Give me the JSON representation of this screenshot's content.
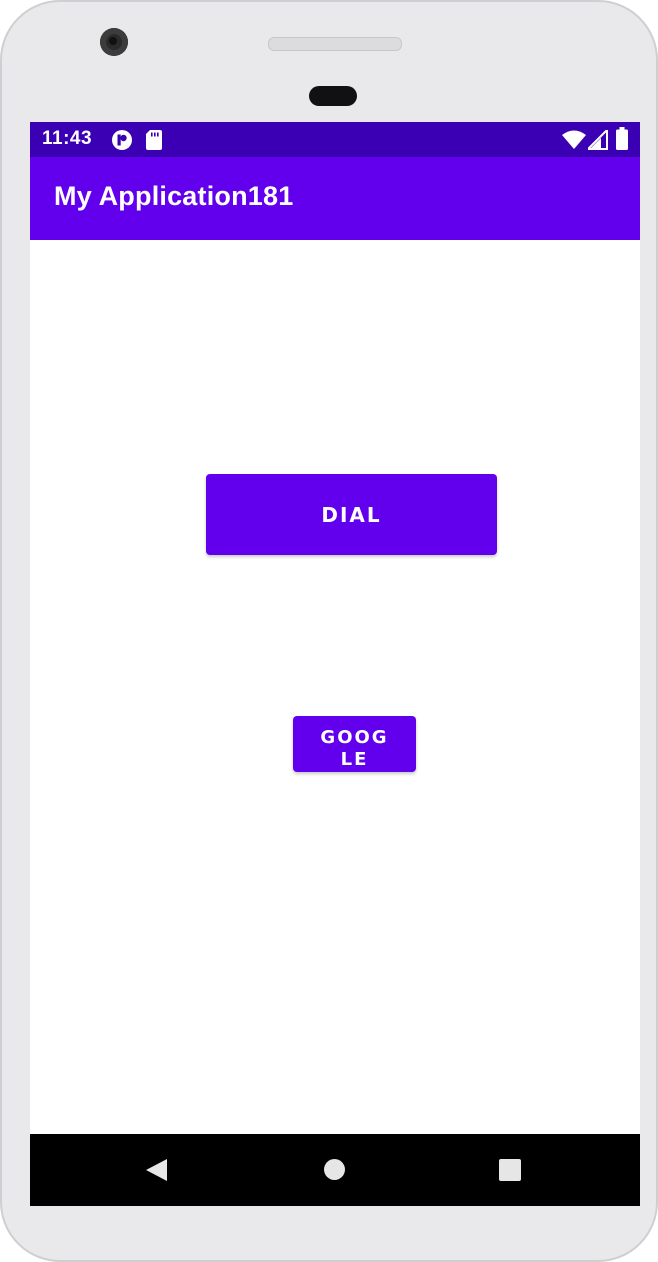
{
  "status_bar": {
    "time": "11:43",
    "icons": [
      "notification-app-icon",
      "sd-card-icon",
      "wifi-icon",
      "cell-signal-icon",
      "battery-icon"
    ],
    "background_color": "#3c00b4"
  },
  "app_bar": {
    "title": "My Application181",
    "background_color": "#6200ee"
  },
  "main": {
    "dial_button_label": "DIAL",
    "google_button_label": "GOOGLE",
    "button_color": "#6200ee"
  },
  "nav_bar": {
    "icons": [
      "back-icon",
      "home-icon",
      "recents-icon"
    ]
  }
}
